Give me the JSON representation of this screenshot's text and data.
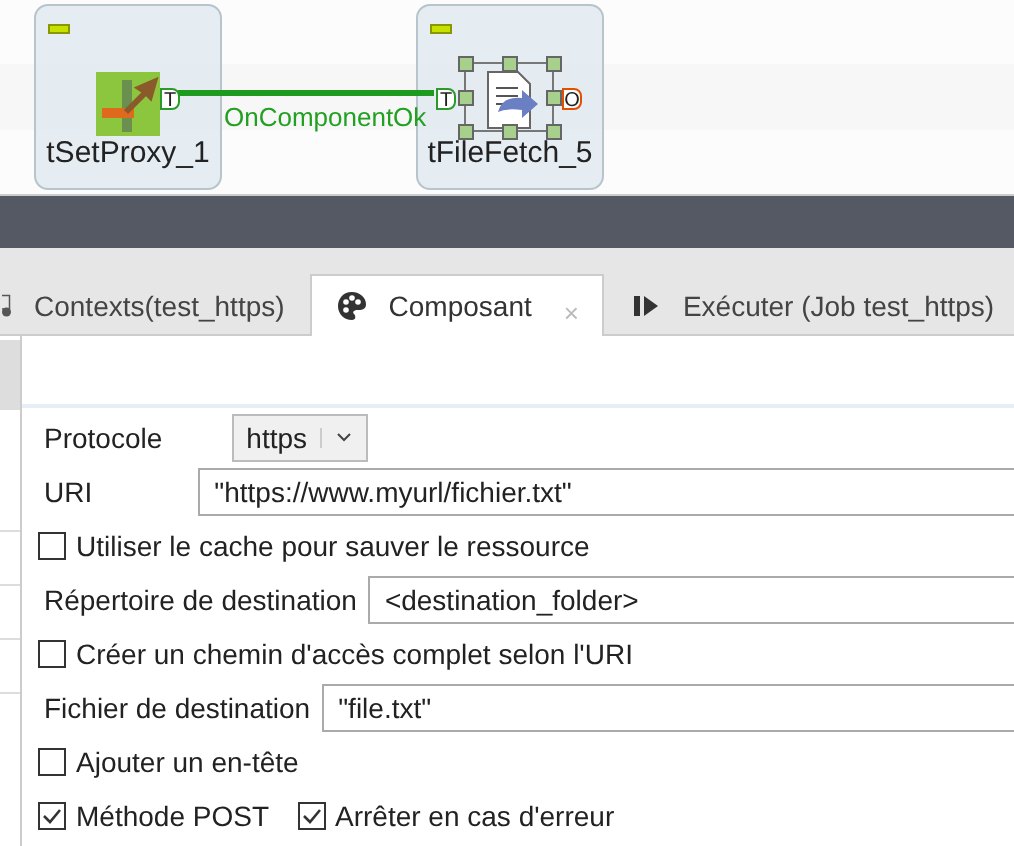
{
  "canvas": {
    "nodes": [
      {
        "label": "tSetProxy_1",
        "selected": false,
        "output_port": "T"
      },
      {
        "label": "tFileFetch_5",
        "selected": true,
        "input_port": "T",
        "output_port": "O"
      }
    ],
    "connection": {
      "label": "OnComponentOk"
    }
  },
  "tabs": [
    {
      "label": "Contexts(test_https)",
      "selected": false
    },
    {
      "label": "Composant",
      "selected": true,
      "close": "×"
    },
    {
      "label": "Exécuter (Job test_https)",
      "selected": false
    }
  ],
  "sidebar": {
    "rows": [
      {
        "selected": true
      },
      {
        "selected": false
      },
      {
        "selected": false
      },
      {
        "selected": false
      },
      {
        "selected": false
      }
    ]
  },
  "form": [
    {
      "kind": "select",
      "label": "Protocole",
      "value": "https"
    },
    {
      "kind": "text",
      "label": "URI",
      "value": "\"https://www.myurl/fichier.txt\""
    },
    {
      "kind": "checkbox",
      "label": "Utiliser le cache pour sauver le ressource",
      "checked": false
    },
    {
      "kind": "text",
      "label": "Répertoire de destination",
      "value": "<destination_folder>"
    },
    {
      "kind": "checkbox",
      "label": "Créer un chemin d'accès complet selon l'URI",
      "checked": false
    },
    {
      "kind": "text",
      "label": "Fichier de destination",
      "value": "\"file.txt\""
    },
    {
      "kind": "checkbox",
      "label": "Ajouter un en-tête",
      "checked": false
    },
    {
      "kind": "checkboxes",
      "items": [
        {
          "label": "Méthode POST",
          "checked": true
        },
        {
          "label": "Arrêter en cas d'erreur",
          "checked": true
        }
      ]
    }
  ]
}
